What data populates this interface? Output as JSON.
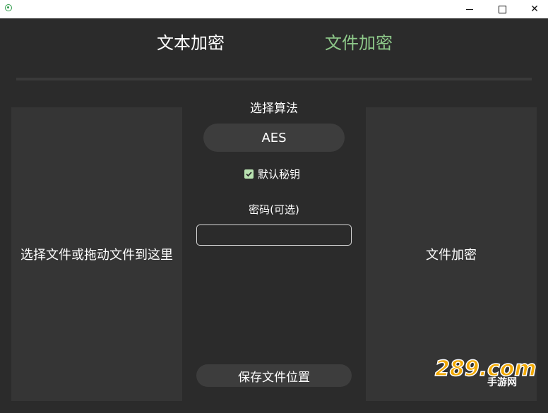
{
  "window": {
    "minimize_glyph": "",
    "maximize_glyph": "",
    "close_glyph": "✕"
  },
  "tabs": [
    {
      "label": "文本加密",
      "active": false
    },
    {
      "label": "文件加密",
      "active": true,
      "color": "#8ec98a"
    }
  ],
  "left_panel": {
    "label": "选择文件或拖动文件到这里"
  },
  "algorithm": {
    "label": "选择算法",
    "selected": "AES"
  },
  "default_key": {
    "label": "默认秘钥",
    "checked": true
  },
  "password": {
    "label": "密码(可选)",
    "value": ""
  },
  "save_location": {
    "label": "保存文件位置"
  },
  "right_panel": {
    "label": "文件加密"
  },
  "watermark": {
    "brand": "289.com",
    "sub": "手游网"
  },
  "colors": {
    "background": "#2b2b2b",
    "panel": "#353535",
    "accent": "#8ec98a"
  }
}
